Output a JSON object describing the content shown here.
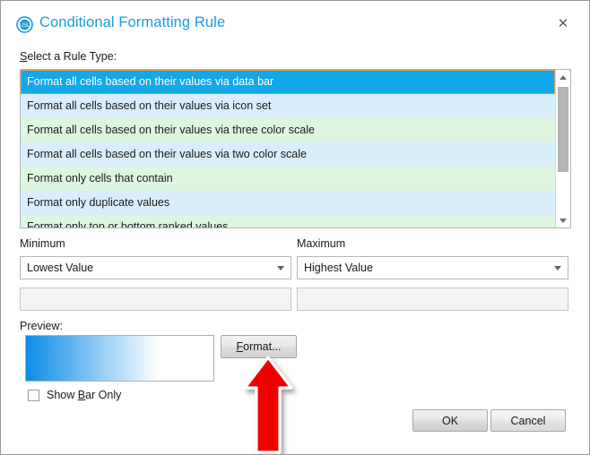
{
  "window": {
    "title": "Conditional Formatting Rule",
    "icon": "app-logo-icon",
    "close_label": "✕"
  },
  "rule_type": {
    "label_prefix": "S",
    "label_rest": "elect a Rule Type:",
    "items": [
      "Format all cells based on their values via data bar",
      "Format all cells based on their values via icon set",
      "Format all cells based on their values via three color scale",
      "Format all cells based on their values via two color scale",
      "Format only cells that contain",
      "Format only duplicate values",
      "Format only top or bottom ranked values"
    ],
    "selected_index": 0,
    "selected_bg": "#13a8e8",
    "selected_border": "#c89a5a",
    "row_color_a": "#ddf6e0",
    "row_color_b": "#d8eefc"
  },
  "minimum": {
    "label": "Minimum",
    "selected_option": "Lowest Value",
    "value": "",
    "value_placeholder": "",
    "disabled": true
  },
  "maximum": {
    "label": "Maximum",
    "selected_option": "Highest Value",
    "value": "",
    "value_placeholder": "",
    "disabled": true
  },
  "preview": {
    "label": "Preview:",
    "bar_start_color": "#0c8ce8",
    "bar_end_color": "#ffffff",
    "format_button_prefix": "F",
    "format_button_rest": "ormat..."
  },
  "show_bar_only": {
    "label_before": "Show ",
    "label_accel": "B",
    "label_after": "ar Only",
    "checked": false
  },
  "footer": {
    "ok_label": "OK",
    "cancel_label": "Cancel"
  },
  "annotation": {
    "arrow_color": "#ee0000",
    "arrow_outline": "#ffffff",
    "points_to": "format-button"
  }
}
